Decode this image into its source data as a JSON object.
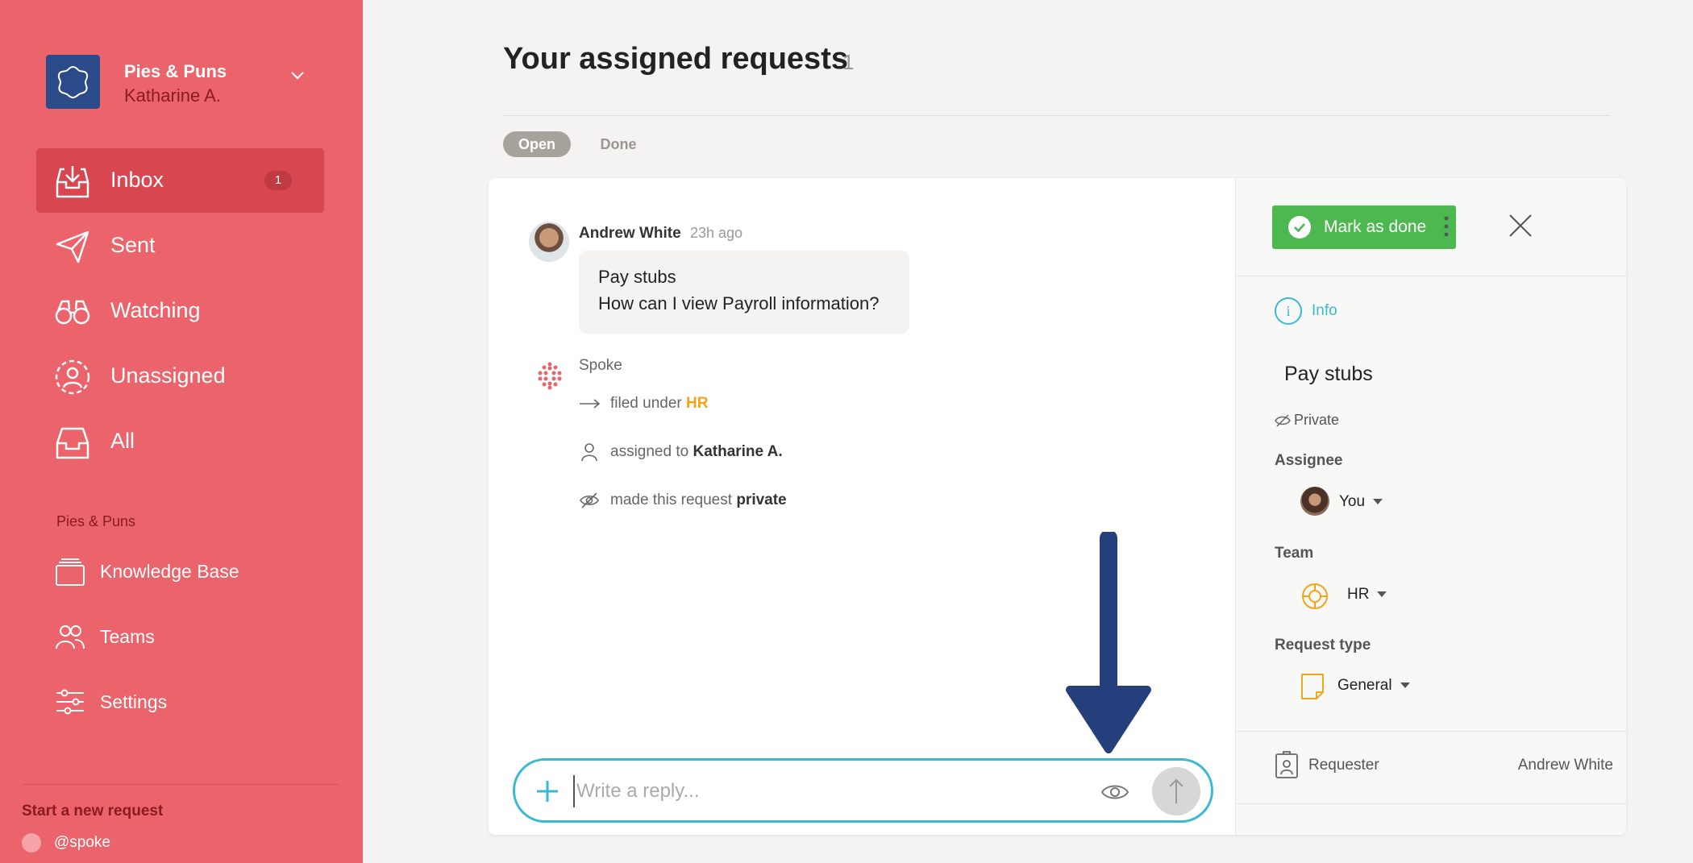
{
  "workspace": {
    "name": "Pies & Puns",
    "user": "Katharine A."
  },
  "sidebar": {
    "nav": [
      {
        "label": "Inbox",
        "icon": "inbox-icon",
        "badge": "1",
        "active": true
      },
      {
        "label": "Sent",
        "icon": "paper-plane-icon"
      },
      {
        "label": "Watching",
        "icon": "binoculars-icon"
      },
      {
        "label": "Unassigned",
        "icon": "user-dashed-icon"
      },
      {
        "label": "All",
        "icon": "tray-icon"
      }
    ],
    "section_title": "Pies & Puns",
    "section_items": [
      {
        "label": "Knowledge Base",
        "icon": "stack-icon"
      },
      {
        "label": "Teams",
        "icon": "users-icon"
      },
      {
        "label": "Settings",
        "icon": "sliders-icon"
      }
    ],
    "new_request": "Start a new request",
    "slack_handle": "@spoke"
  },
  "header": {
    "title": "Your assigned requests",
    "count": "1",
    "tabs": [
      {
        "label": "Open",
        "active": true
      },
      {
        "label": "Done"
      }
    ]
  },
  "conversation": {
    "message": {
      "author": "Andrew White",
      "time": "23h ago",
      "title": "Pay stubs",
      "body": "How can I view Payroll information?"
    },
    "system_name": "Spoke",
    "events": [
      {
        "text": "filed under ",
        "highlight": "HR"
      },
      {
        "text": "assigned to ",
        "highlight": "Katharine A."
      },
      {
        "text": "made this request ",
        "highlight": "private"
      }
    ],
    "reply_placeholder": "Write a reply..."
  },
  "panel": {
    "mark_done": "Mark as done",
    "info_tab": "Info",
    "request_title": "Pay stubs",
    "privacy": "Private",
    "assignee_label": "Assignee",
    "assignee_value": "You",
    "team_label": "Team",
    "team_value": "HR",
    "request_type_label": "Request type",
    "request_type_value": "General",
    "requester_label": "Requester",
    "requester_value": "Andrew White"
  },
  "colors": {
    "sidebar": "#ec646b",
    "sidebar_active": "#d84650",
    "accent": "#3ab8d4",
    "success": "#4cb84f",
    "highlight": "#f2a51a",
    "annotation_arrow": "#243f7c"
  }
}
